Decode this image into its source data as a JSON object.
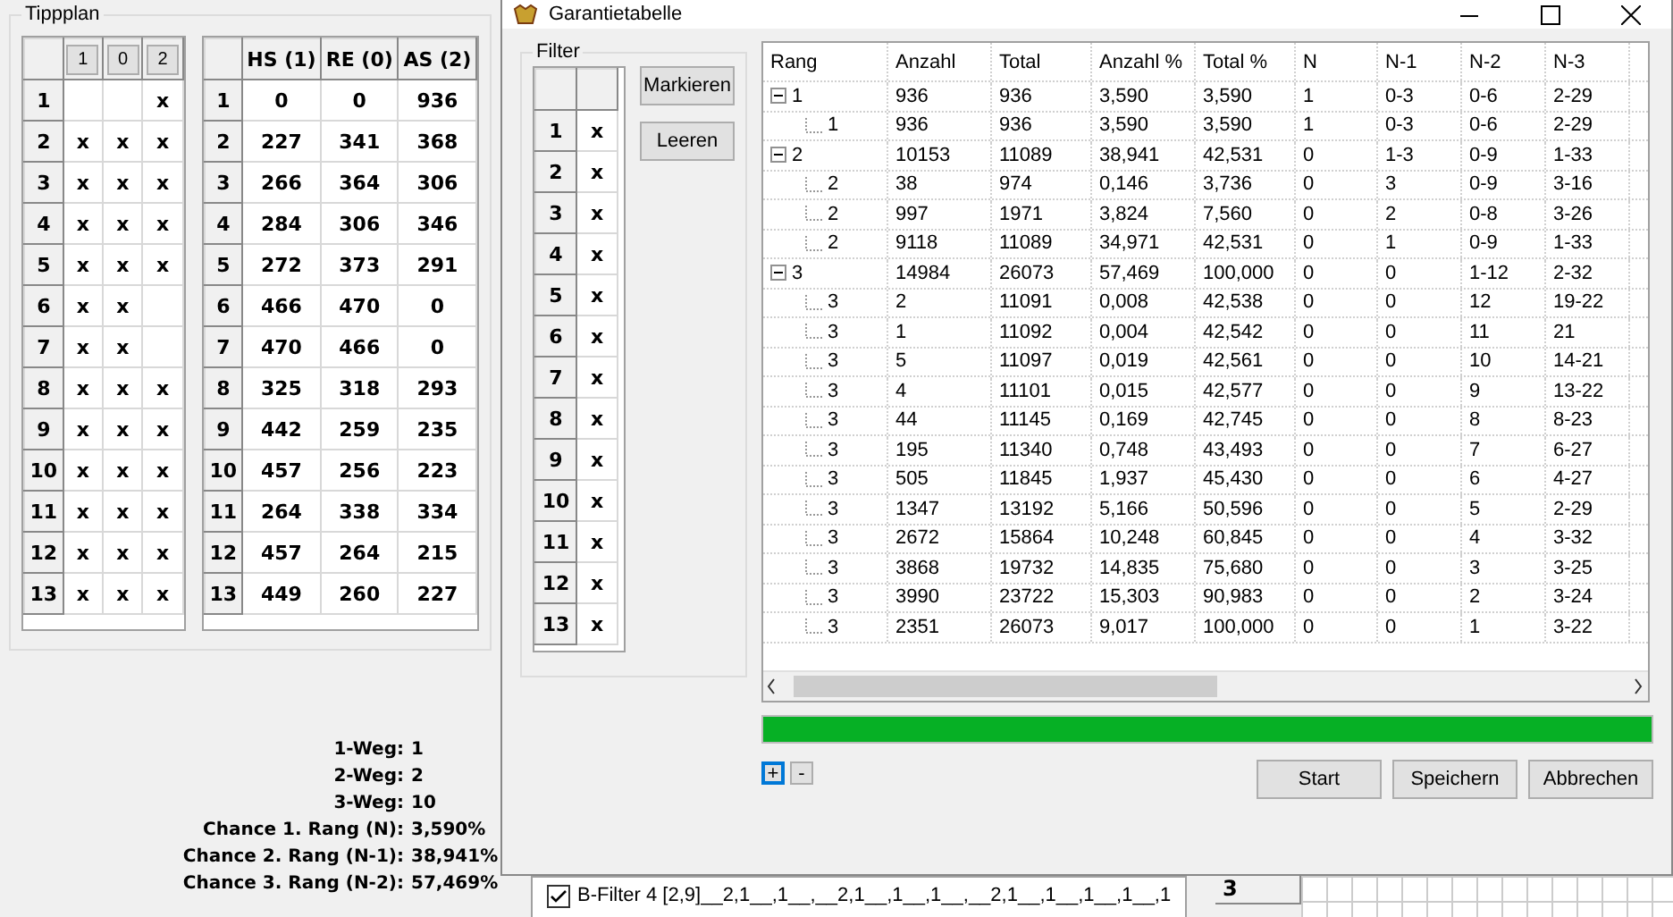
{
  "tippplan": {
    "title": "Tippplan",
    "tip_grid": {
      "columns": [
        "1",
        "0",
        "2"
      ],
      "rows": [
        {
          "label": "1",
          "cells": [
            null,
            null,
            "x"
          ]
        },
        {
          "label": "2",
          "cells": [
            "x",
            "x",
            "x"
          ]
        },
        {
          "label": "3",
          "cells": [
            "x",
            "x",
            "x"
          ]
        },
        {
          "label": "4",
          "cells": [
            "x",
            "x",
            "x"
          ]
        },
        {
          "label": "5",
          "cells": [
            "x",
            "x",
            "x"
          ]
        },
        {
          "label": "6",
          "cells": [
            "x",
            "x",
            null
          ]
        },
        {
          "label": "7",
          "cells": [
            "x",
            "x",
            null
          ]
        },
        {
          "label": "8",
          "cells": [
            "x",
            "x",
            "x"
          ]
        },
        {
          "label": "9",
          "cells": [
            "x",
            "x",
            "x"
          ]
        },
        {
          "label": "10",
          "cells": [
            "x",
            "x",
            "x"
          ]
        },
        {
          "label": "11",
          "cells": [
            "x",
            "x",
            "x"
          ]
        },
        {
          "label": "12",
          "cells": [
            "x",
            "x",
            "x"
          ]
        },
        {
          "label": "13",
          "cells": [
            "x",
            "x",
            "x"
          ]
        }
      ]
    },
    "count_grid": {
      "columns": [
        "HS (1)",
        "RE (0)",
        "AS (2)"
      ],
      "rows": [
        {
          "label": "1",
          "cells": [
            "0",
            "0",
            "936"
          ]
        },
        {
          "label": "2",
          "cells": [
            "227",
            "341",
            "368"
          ]
        },
        {
          "label": "3",
          "cells": [
            "266",
            "364",
            "306"
          ]
        },
        {
          "label": "4",
          "cells": [
            "284",
            "306",
            "346"
          ]
        },
        {
          "label": "5",
          "cells": [
            "272",
            "373",
            "291"
          ]
        },
        {
          "label": "6",
          "cells": [
            "466",
            "470",
            "0"
          ]
        },
        {
          "label": "7",
          "cells": [
            "470",
            "466",
            "0"
          ]
        },
        {
          "label": "8",
          "cells": [
            "325",
            "318",
            "293"
          ]
        },
        {
          "label": "9",
          "cells": [
            "442",
            "259",
            "235"
          ]
        },
        {
          "label": "10",
          "cells": [
            "457",
            "256",
            "223"
          ]
        },
        {
          "label": "11",
          "cells": [
            "264",
            "338",
            "334"
          ]
        },
        {
          "label": "12",
          "cells": [
            "457",
            "264",
            "215"
          ]
        },
        {
          "label": "13",
          "cells": [
            "449",
            "260",
            "227"
          ]
        }
      ]
    }
  },
  "stats": [
    {
      "label": "1-Weg:",
      "value": "1"
    },
    {
      "label": "2-Weg:",
      "value": "2"
    },
    {
      "label": "3-Weg:",
      "value": "10"
    },
    {
      "label": "Chance 1. Rang (N):",
      "value": "3,590%"
    },
    {
      "label": "Chance 2. Rang (N-1):",
      "value": "38,941%"
    },
    {
      "label": "Chance 3. Rang (N-2):",
      "value": "57,469%"
    }
  ],
  "dialog": {
    "title": "Garantietabelle",
    "filter": {
      "title": "Filter",
      "rows": [
        {
          "label": "1",
          "mark": "x"
        },
        {
          "label": "2",
          "mark": "x"
        },
        {
          "label": "3",
          "mark": "x"
        },
        {
          "label": "4",
          "mark": "x"
        },
        {
          "label": "5",
          "mark": "x"
        },
        {
          "label": "6",
          "mark": "x"
        },
        {
          "label": "7",
          "mark": "x"
        },
        {
          "label": "8",
          "mark": "x"
        },
        {
          "label": "9",
          "mark": "x"
        },
        {
          "label": "10",
          "mark": "x"
        },
        {
          "label": "11",
          "mark": "x"
        },
        {
          "label": "12",
          "mark": "x"
        },
        {
          "label": "13",
          "mark": "x"
        }
      ],
      "buttons": [
        "Markieren",
        "Leeren"
      ]
    },
    "table": {
      "columns": [
        "Rang",
        "Anzahl",
        "Total",
        "Anzahl %",
        "Total %",
        "N",
        "N-1",
        "N-2",
        "N-3"
      ],
      "rows": [
        {
          "expanded": true,
          "cells": [
            "1",
            "936",
            "936",
            "3,590",
            "3,590",
            "1",
            "0-3",
            "0-6",
            "2-29"
          ],
          "children": [
            {
              "cells": [
                "1",
                "936",
                "936",
                "3,590",
                "3,590",
                "1",
                "0-3",
                "0-6",
                "2-29"
              ]
            }
          ]
        },
        {
          "expanded": true,
          "cells": [
            "2",
            "10153",
            "11089",
            "38,941",
            "42,531",
            "0",
            "1-3",
            "0-9",
            "1-33"
          ],
          "children": [
            {
              "cells": [
                "2",
                "38",
                "974",
                "0,146",
                "3,736",
                "0",
                "3",
                "0-9",
                "3-16"
              ]
            },
            {
              "cells": [
                "2",
                "997",
                "1971",
                "3,824",
                "7,560",
                "0",
                "2",
                "0-8",
                "3-26"
              ]
            },
            {
              "cells": [
                "2",
                "9118",
                "11089",
                "34,971",
                "42,531",
                "0",
                "1",
                "0-9",
                "1-33"
              ]
            }
          ]
        },
        {
          "expanded": true,
          "cells": [
            "3",
            "14984",
            "26073",
            "57,469",
            "100,000",
            "0",
            "0",
            "1-12",
            "2-32"
          ],
          "children": [
            {
              "cells": [
                "3",
                "2",
                "11091",
                "0,008",
                "42,538",
                "0",
                "0",
                "12",
                "19-22"
              ]
            },
            {
              "cells": [
                "3",
                "1",
                "11092",
                "0,004",
                "42,542",
                "0",
                "0",
                "11",
                "21"
              ]
            },
            {
              "cells": [
                "3",
                "5",
                "11097",
                "0,019",
                "42,561",
                "0",
                "0",
                "10",
                "14-21"
              ]
            },
            {
              "cells": [
                "3",
                "4",
                "11101",
                "0,015",
                "42,577",
                "0",
                "0",
                "9",
                "13-22"
              ]
            },
            {
              "cells": [
                "3",
                "44",
                "11145",
                "0,169",
                "42,745",
                "0",
                "0",
                "8",
                "8-23"
              ]
            },
            {
              "cells": [
                "3",
                "195",
                "11340",
                "0,748",
                "43,493",
                "0",
                "0",
                "7",
                "6-27"
              ]
            },
            {
              "cells": [
                "3",
                "505",
                "11845",
                "1,937",
                "45,430",
                "0",
                "0",
                "6",
                "4-27"
              ]
            },
            {
              "cells": [
                "3",
                "1347",
                "13192",
                "5,166",
                "50,596",
                "0",
                "0",
                "5",
                "2-29"
              ]
            },
            {
              "cells": [
                "3",
                "2672",
                "15864",
                "10,248",
                "60,845",
                "0",
                "0",
                "4",
                "3-32"
              ]
            },
            {
              "cells": [
                "3",
                "3868",
                "19732",
                "14,835",
                "75,680",
                "0",
                "0",
                "3",
                "3-25"
              ]
            },
            {
              "cells": [
                "3",
                "3990",
                "23722",
                "15,303",
                "90,983",
                "0",
                "0",
                "2",
                "3-24"
              ]
            },
            {
              "cells": [
                "3",
                "2351",
                "26073",
                "9,017",
                "100,000",
                "0",
                "0",
                "1",
                "3-22"
              ]
            }
          ]
        }
      ]
    },
    "progress": {
      "level": 1
    },
    "small_buttons": [
      {
        "label": "+",
        "focused": true
      },
      {
        "label": "-",
        "focused": false
      }
    ],
    "buttons": [
      "Start",
      "Speichern",
      "Abbrechen"
    ]
  },
  "filter_list": [
    {
      "label": "B-Filter 4 [2,9]__2,1__,1__,__2,1__,1__,1__,__2,1__,1__,1__,1__,1",
      "checked": true
    }
  ],
  "side_grid": {
    "label": "3"
  }
}
